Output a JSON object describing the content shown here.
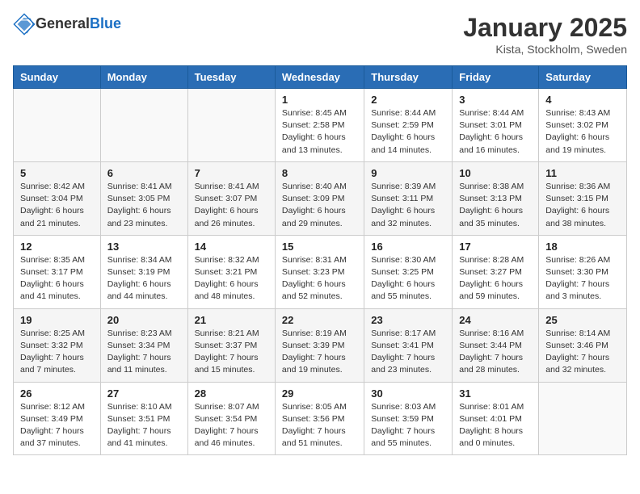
{
  "header": {
    "logo_general": "General",
    "logo_blue": "Blue",
    "title": "January 2025",
    "subtitle": "Kista, Stockholm, Sweden"
  },
  "days_of_week": [
    "Sunday",
    "Monday",
    "Tuesday",
    "Wednesday",
    "Thursday",
    "Friday",
    "Saturday"
  ],
  "weeks": [
    [
      {
        "day": "",
        "info": ""
      },
      {
        "day": "",
        "info": ""
      },
      {
        "day": "",
        "info": ""
      },
      {
        "day": "1",
        "info": "Sunrise: 8:45 AM\nSunset: 2:58 PM\nDaylight: 6 hours\nand 13 minutes."
      },
      {
        "day": "2",
        "info": "Sunrise: 8:44 AM\nSunset: 2:59 PM\nDaylight: 6 hours\nand 14 minutes."
      },
      {
        "day": "3",
        "info": "Sunrise: 8:44 AM\nSunset: 3:01 PM\nDaylight: 6 hours\nand 16 minutes."
      },
      {
        "day": "4",
        "info": "Sunrise: 8:43 AM\nSunset: 3:02 PM\nDaylight: 6 hours\nand 19 minutes."
      }
    ],
    [
      {
        "day": "5",
        "info": "Sunrise: 8:42 AM\nSunset: 3:04 PM\nDaylight: 6 hours\nand 21 minutes."
      },
      {
        "day": "6",
        "info": "Sunrise: 8:41 AM\nSunset: 3:05 PM\nDaylight: 6 hours\nand 23 minutes."
      },
      {
        "day": "7",
        "info": "Sunrise: 8:41 AM\nSunset: 3:07 PM\nDaylight: 6 hours\nand 26 minutes."
      },
      {
        "day": "8",
        "info": "Sunrise: 8:40 AM\nSunset: 3:09 PM\nDaylight: 6 hours\nand 29 minutes."
      },
      {
        "day": "9",
        "info": "Sunrise: 8:39 AM\nSunset: 3:11 PM\nDaylight: 6 hours\nand 32 minutes."
      },
      {
        "day": "10",
        "info": "Sunrise: 8:38 AM\nSunset: 3:13 PM\nDaylight: 6 hours\nand 35 minutes."
      },
      {
        "day": "11",
        "info": "Sunrise: 8:36 AM\nSunset: 3:15 PM\nDaylight: 6 hours\nand 38 minutes."
      }
    ],
    [
      {
        "day": "12",
        "info": "Sunrise: 8:35 AM\nSunset: 3:17 PM\nDaylight: 6 hours\nand 41 minutes."
      },
      {
        "day": "13",
        "info": "Sunrise: 8:34 AM\nSunset: 3:19 PM\nDaylight: 6 hours\nand 44 minutes."
      },
      {
        "day": "14",
        "info": "Sunrise: 8:32 AM\nSunset: 3:21 PM\nDaylight: 6 hours\nand 48 minutes."
      },
      {
        "day": "15",
        "info": "Sunrise: 8:31 AM\nSunset: 3:23 PM\nDaylight: 6 hours\nand 52 minutes."
      },
      {
        "day": "16",
        "info": "Sunrise: 8:30 AM\nSunset: 3:25 PM\nDaylight: 6 hours\nand 55 minutes."
      },
      {
        "day": "17",
        "info": "Sunrise: 8:28 AM\nSunset: 3:27 PM\nDaylight: 6 hours\nand 59 minutes."
      },
      {
        "day": "18",
        "info": "Sunrise: 8:26 AM\nSunset: 3:30 PM\nDaylight: 7 hours\nand 3 minutes."
      }
    ],
    [
      {
        "day": "19",
        "info": "Sunrise: 8:25 AM\nSunset: 3:32 PM\nDaylight: 7 hours\nand 7 minutes."
      },
      {
        "day": "20",
        "info": "Sunrise: 8:23 AM\nSunset: 3:34 PM\nDaylight: 7 hours\nand 11 minutes."
      },
      {
        "day": "21",
        "info": "Sunrise: 8:21 AM\nSunset: 3:37 PM\nDaylight: 7 hours\nand 15 minutes."
      },
      {
        "day": "22",
        "info": "Sunrise: 8:19 AM\nSunset: 3:39 PM\nDaylight: 7 hours\nand 19 minutes."
      },
      {
        "day": "23",
        "info": "Sunrise: 8:17 AM\nSunset: 3:41 PM\nDaylight: 7 hours\nand 23 minutes."
      },
      {
        "day": "24",
        "info": "Sunrise: 8:16 AM\nSunset: 3:44 PM\nDaylight: 7 hours\nand 28 minutes."
      },
      {
        "day": "25",
        "info": "Sunrise: 8:14 AM\nSunset: 3:46 PM\nDaylight: 7 hours\nand 32 minutes."
      }
    ],
    [
      {
        "day": "26",
        "info": "Sunrise: 8:12 AM\nSunset: 3:49 PM\nDaylight: 7 hours\nand 37 minutes."
      },
      {
        "day": "27",
        "info": "Sunrise: 8:10 AM\nSunset: 3:51 PM\nDaylight: 7 hours\nand 41 minutes."
      },
      {
        "day": "28",
        "info": "Sunrise: 8:07 AM\nSunset: 3:54 PM\nDaylight: 7 hours\nand 46 minutes."
      },
      {
        "day": "29",
        "info": "Sunrise: 8:05 AM\nSunset: 3:56 PM\nDaylight: 7 hours\nand 51 minutes."
      },
      {
        "day": "30",
        "info": "Sunrise: 8:03 AM\nSunset: 3:59 PM\nDaylight: 7 hours\nand 55 minutes."
      },
      {
        "day": "31",
        "info": "Sunrise: 8:01 AM\nSunset: 4:01 PM\nDaylight: 8 hours\nand 0 minutes."
      },
      {
        "day": "",
        "info": ""
      }
    ]
  ]
}
